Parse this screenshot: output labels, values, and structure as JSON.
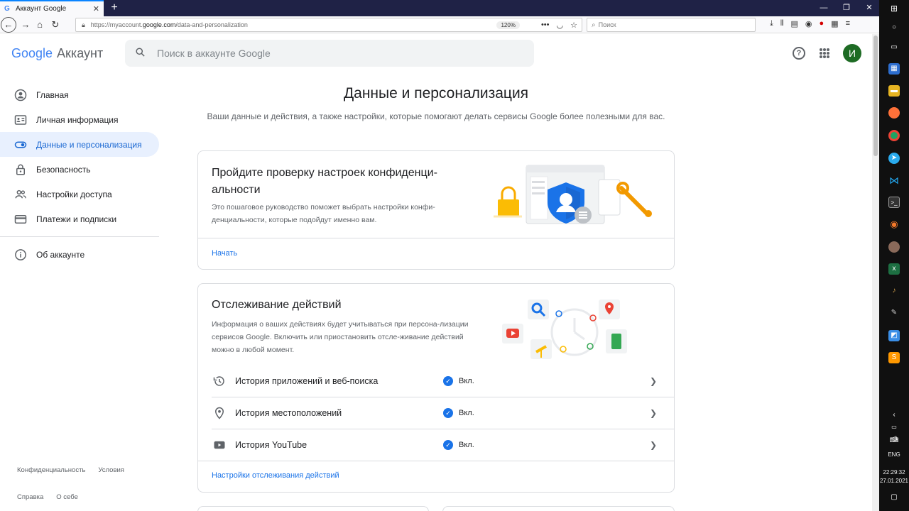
{
  "browser": {
    "tab_title": "Аккаунт Google",
    "tab_close": "✕",
    "newtab": "+",
    "url_prefix": "https://myaccount.",
    "url_domain": "google.com",
    "url_path": "/data-and-personalization",
    "zoom": "120%",
    "search_placeholder": "Поиск"
  },
  "header": {
    "logo_text": "Google",
    "logo_suffix": "Аккаунт",
    "search_placeholder": "Поиск в аккаунте Google",
    "avatar_letter": "И"
  },
  "sidebar": {
    "items": [
      {
        "label": "Главная"
      },
      {
        "label": "Личная информация"
      },
      {
        "label": "Данные и персонализация"
      },
      {
        "label": "Безопасность"
      },
      {
        "label": "Настройки доступа"
      },
      {
        "label": "Платежи и подписки"
      }
    ],
    "about": "Об аккаунте",
    "footer": {
      "privacy": "Конфиденциальность",
      "terms": "Условия",
      "help": "Справка",
      "about": "О себе"
    }
  },
  "main": {
    "title": "Данные и персонализация",
    "subtitle": "Ваши данные и действия, а также настройки, которые помогают делать сервисы Google более полезными для вас.",
    "privacy_card": {
      "title": "Пройдите проверку настроек конфиденци-альности",
      "desc": "Это пошаговое руководство поможет выбрать настройки конфи-денциальности, которые подойдут именно вам.",
      "link": "Начать"
    },
    "activity_card": {
      "title": "Отслеживание действий",
      "desc": "Информация о ваших действиях будет учитываться при персона-лизации сервисов Google. Включить или приостановить отсле-живание действий можно в любой момент.",
      "rows": [
        {
          "label": "История приложений и веб-поиска",
          "status": "Вкл."
        },
        {
          "label": "История местоположений",
          "status": "Вкл."
        },
        {
          "label": "История YouTube",
          "status": "Вкл."
        }
      ],
      "link": "Настройки отслеживания действий"
    }
  },
  "taskbar": {
    "lang": "ENG",
    "time": "22:29:32",
    "date": "27.01.2021"
  },
  "colors": {
    "accent": "#1a73e8",
    "active_bg": "#e8f0fe",
    "avatar": "#1e6b24"
  }
}
